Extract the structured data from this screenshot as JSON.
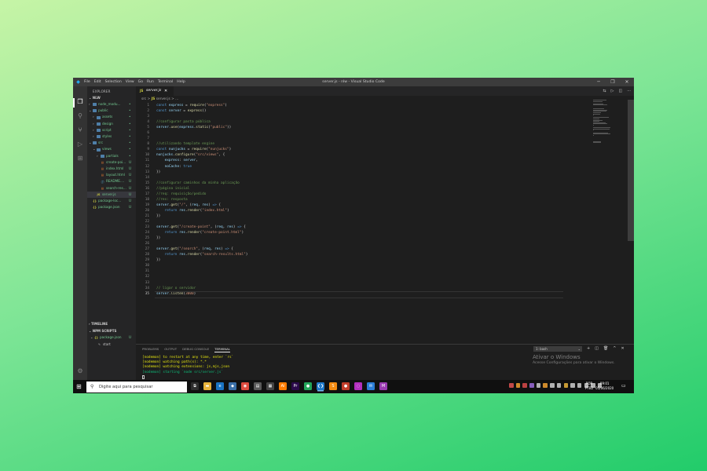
{
  "window": {
    "title": "server.js - nlw - Visual Studio Code",
    "menu": [
      "File",
      "Edit",
      "Selection",
      "View",
      "Go",
      "Run",
      "Terminal",
      "Help"
    ],
    "controls": [
      "─",
      "❐",
      "✕"
    ]
  },
  "activity_bar": [
    "files-icon",
    "search-icon",
    "source-control-icon",
    "run-debug-icon",
    "extensions-icon",
    "settings-gear-icon"
  ],
  "sidebar": {
    "title": "EXPLORER",
    "root": "NLW",
    "tree": [
      {
        "name": "node_modu...",
        "status": "",
        "type": "folder",
        "depth": 0,
        "open": false,
        "color": "green"
      },
      {
        "name": "public",
        "status": "",
        "type": "folder",
        "depth": 0,
        "open": true,
        "color": "green"
      },
      {
        "name": "assets",
        "status": "",
        "type": "folder",
        "depth": 1,
        "open": false,
        "color": "green"
      },
      {
        "name": "design",
        "status": "",
        "type": "folder",
        "depth": 1,
        "open": false,
        "color": "green"
      },
      {
        "name": "script",
        "status": "",
        "type": "folder",
        "depth": 1,
        "open": false,
        "color": "green"
      },
      {
        "name": "styles",
        "status": "",
        "type": "folder",
        "depth": 1,
        "open": false,
        "color": "green"
      },
      {
        "name": "src",
        "status": "",
        "type": "folder",
        "depth": 0,
        "open": true,
        "color": "green"
      },
      {
        "name": "views",
        "status": "",
        "type": "folder",
        "depth": 1,
        "open": true,
        "color": "green"
      },
      {
        "name": "partials",
        "status": "",
        "type": "folder",
        "depth": 2,
        "open": false,
        "color": "green"
      },
      {
        "name": "create-poi...",
        "status": "U",
        "type": "html",
        "depth": 2,
        "color": "green"
      },
      {
        "name": "index.html",
        "status": "U",
        "type": "html",
        "depth": 2,
        "color": "green"
      },
      {
        "name": "layout.html",
        "status": "U",
        "type": "html",
        "depth": 2,
        "color": "green"
      },
      {
        "name": "README....",
        "status": "U",
        "type": "md",
        "depth": 2,
        "color": "green"
      },
      {
        "name": "search-res...",
        "status": "U",
        "type": "html",
        "depth": 2,
        "color": "green"
      },
      {
        "name": "server.js",
        "status": "U",
        "type": "js",
        "depth": 1,
        "color": "green",
        "selected": true
      },
      {
        "name": "package-loc...",
        "status": "U",
        "type": "json",
        "depth": 0,
        "color": "green"
      },
      {
        "name": "package.json",
        "status": "U",
        "type": "json",
        "depth": 0,
        "color": "green"
      }
    ],
    "timeline": "TIMELINE",
    "npm_scripts": "NPM SCRIPTS",
    "npm_file": "package.json",
    "npm_file_status": "U",
    "npm_script": "start"
  },
  "editor": {
    "tab": {
      "icon": "JS",
      "label": "server.js",
      "close": "✕"
    },
    "toolbar": [
      "⇆",
      "▷",
      "◫",
      "···"
    ],
    "breadcrumb": {
      "folder": "src",
      "sep": ">",
      "icon": "JS",
      "file": "server.js",
      "tail": "> ..."
    },
    "lines": [
      [
        [
          "k",
          "const "
        ],
        [
          "v",
          "express"
        ],
        [
          "p",
          " = "
        ],
        [
          "fn",
          "require"
        ],
        [
          "p",
          "("
        ],
        [
          "s",
          "\"express\""
        ],
        [
          "p",
          ")"
        ]
      ],
      [
        [
          "k",
          "const "
        ],
        [
          "v",
          "server"
        ],
        [
          "p",
          " = "
        ],
        [
          "fn",
          "express"
        ],
        [
          "p",
          "()"
        ]
      ],
      [],
      [
        [
          "c",
          "//configurar pasta pública"
        ]
      ],
      [
        [
          "v",
          "server"
        ],
        [
          "p",
          "."
        ],
        [
          "fn",
          "use"
        ],
        [
          "p",
          "("
        ],
        [
          "v",
          "express"
        ],
        [
          "p",
          "."
        ],
        [
          "fn",
          "static"
        ],
        [
          "p",
          "("
        ],
        [
          "s",
          "\"public\""
        ],
        [
          "p",
          "))"
        ]
      ],
      [],
      [],
      [
        [
          "c",
          "//utilizando template engine"
        ]
      ],
      [
        [
          "k",
          "const "
        ],
        [
          "v",
          "nunjucks"
        ],
        [
          "p",
          " = "
        ],
        [
          "fn",
          "require"
        ],
        [
          "p",
          "("
        ],
        [
          "s",
          "\"nunjucks\""
        ],
        [
          "p",
          ")"
        ]
      ],
      [
        [
          "v",
          "nunjucks"
        ],
        [
          "p",
          "."
        ],
        [
          "fn",
          "configure"
        ],
        [
          "p",
          "("
        ],
        [
          "s",
          "\"src/views\""
        ],
        [
          "p",
          ", {"
        ]
      ],
      [
        [
          "p",
          "    "
        ],
        [
          "v",
          "express"
        ],
        [
          "p",
          ": "
        ],
        [
          "v",
          "server"
        ],
        [
          "p",
          ","
        ]
      ],
      [
        [
          "p",
          "    "
        ],
        [
          "v",
          "noCache"
        ],
        [
          "p",
          ": "
        ],
        [
          "k",
          "true"
        ]
      ],
      [
        [
          "p",
          "})"
        ]
      ],
      [],
      [
        [
          "c",
          "//configurar caminhos da minha aplicação"
        ]
      ],
      [
        [
          "c",
          "//página inicial"
        ]
      ],
      [
        [
          "c",
          "//req: requisição/pedido"
        ]
      ],
      [
        [
          "c",
          "//res: resposta"
        ]
      ],
      [
        [
          "v",
          "server"
        ],
        [
          "p",
          "."
        ],
        [
          "fn",
          "get"
        ],
        [
          "p",
          "("
        ],
        [
          "s",
          "\"/\""
        ],
        [
          "p",
          ", ("
        ],
        [
          "v",
          "req"
        ],
        [
          "p",
          ", "
        ],
        [
          "v",
          "res"
        ],
        [
          "p",
          ") "
        ],
        [
          "k",
          "=>"
        ],
        [
          "p",
          " {"
        ]
      ],
      [
        [
          "p",
          "    "
        ],
        [
          "k",
          "return "
        ],
        [
          "v",
          "res"
        ],
        [
          "p",
          "."
        ],
        [
          "fn",
          "render"
        ],
        [
          "p",
          "("
        ],
        [
          "s",
          "\"index.html\""
        ],
        [
          "p",
          ")"
        ]
      ],
      [
        [
          "p",
          "})"
        ]
      ],
      [],
      [
        [
          "v",
          "server"
        ],
        [
          "p",
          "."
        ],
        [
          "fn",
          "get"
        ],
        [
          "p",
          "("
        ],
        [
          "s",
          "\"/create-point\""
        ],
        [
          "p",
          ", ("
        ],
        [
          "v",
          "req"
        ],
        [
          "p",
          ", "
        ],
        [
          "v",
          "res"
        ],
        [
          "p",
          ") "
        ],
        [
          "k",
          "=>"
        ],
        [
          "p",
          " {"
        ]
      ],
      [
        [
          "p",
          "    "
        ],
        [
          "k",
          "return "
        ],
        [
          "v",
          "res"
        ],
        [
          "p",
          "."
        ],
        [
          "fn",
          "render"
        ],
        [
          "p",
          "("
        ],
        [
          "s",
          "\"create-point.html\""
        ],
        [
          "p",
          ")"
        ]
      ],
      [
        [
          "p",
          "})"
        ]
      ],
      [],
      [
        [
          "v",
          "server"
        ],
        [
          "p",
          "."
        ],
        [
          "fn",
          "get"
        ],
        [
          "p",
          "("
        ],
        [
          "s",
          "\"/search\""
        ],
        [
          "p",
          ", ("
        ],
        [
          "v",
          "req"
        ],
        [
          "p",
          ", "
        ],
        [
          "v",
          "res"
        ],
        [
          "p",
          ") "
        ],
        [
          "k",
          "=>"
        ],
        [
          "p",
          " {"
        ]
      ],
      [
        [
          "p",
          "    "
        ],
        [
          "k",
          "return "
        ],
        [
          "v",
          "res"
        ],
        [
          "p",
          "."
        ],
        [
          "fn",
          "render"
        ],
        [
          "p",
          "("
        ],
        [
          "s",
          "\"search-results.html\""
        ],
        [
          "p",
          ")"
        ]
      ],
      [
        [
          "p",
          "})"
        ]
      ],
      [],
      [],
      [],
      [],
      [
        [
          "c",
          "// ligar o servidor"
        ]
      ],
      [
        [
          "v",
          "server"
        ],
        [
          "p",
          "."
        ],
        [
          "fn",
          "listen"
        ],
        [
          "p",
          "("
        ],
        [
          "s",
          "3000"
        ],
        [
          "p",
          ")"
        ]
      ]
    ],
    "cursor_line": 35
  },
  "panel": {
    "tabs": [
      "PROBLEMS",
      "OUTPUT",
      "DEBUG CONSOLE",
      "TERMINAL"
    ],
    "active_tab": "TERMINAL",
    "shell": "1: bash",
    "controls": [
      "+",
      "◫",
      "🗑",
      "^",
      "✕"
    ],
    "terminal": [
      {
        "text": "[nodemon] to restart at any time, enter `rs`",
        "color": "yellow"
      },
      {
        "text": "[nodemon] watching path(s): *.*",
        "color": "yellow"
      },
      {
        "text": "[nodemon] watching extensions: js,mjs,json",
        "color": "yellow"
      },
      {
        "text": "[nodemon] starting `node src/server.js`",
        "color": "green"
      }
    ]
  },
  "activation": {
    "title": "Ativar o Windows",
    "subtitle": "Acesse Configurações para ativar o Windows."
  },
  "taskbar": {
    "search_placeholder": "Digite aqui para pesquisar",
    "apps": [
      {
        "name": "task-view",
        "color": "#2d2d2d",
        "glyph": "⧉"
      },
      {
        "name": "file-explorer",
        "color": "#e8b33a",
        "glyph": "▬"
      },
      {
        "name": "edge",
        "color": "#1a73c2",
        "glyph": "e"
      },
      {
        "name": "app-store",
        "color": "#3a6fa8",
        "glyph": "◆"
      },
      {
        "name": "chrome",
        "color": "#dd4b3e",
        "glyph": "◉"
      },
      {
        "name": "notes",
        "color": "#5a5a5a",
        "glyph": "▤"
      },
      {
        "name": "calculator",
        "color": "#444",
        "glyph": "▦"
      },
      {
        "name": "illustrator",
        "color": "#ff7c00",
        "glyph": "Ai"
      },
      {
        "name": "premiere",
        "color": "#2a0a4a",
        "glyph": "Pr"
      },
      {
        "name": "app-green",
        "color": "#23a55a",
        "glyph": "●"
      },
      {
        "name": "vscode",
        "color": "#1e78c8",
        "glyph": "❮❯",
        "active": true
      },
      {
        "name": "sublime",
        "color": "#f28a10",
        "glyph": "S"
      },
      {
        "name": "app-red",
        "color": "#c13d2a",
        "glyph": "●"
      },
      {
        "name": "app-purple",
        "color": "#b22fbe",
        "glyph": "◌"
      },
      {
        "name": "mail",
        "color": "#2b7dd6",
        "glyph": "✉"
      },
      {
        "name": "app-mc",
        "color": "#9a3bb1",
        "glyph": "M"
      }
    ],
    "tray_colors": [
      "#e05252",
      "#f0a030",
      "#d94a4a",
      "#9b6bd9",
      "#cccccc",
      "#f0a030",
      "#cccccc",
      "#cccccc",
      "#e8b33a",
      "#cccccc",
      "#cccccc",
      "#cccccc",
      "#cccccc",
      "#cccccc"
    ],
    "lang": "POR",
    "layout": "PTB2",
    "time": "09:01",
    "date": "05/06/2020"
  }
}
